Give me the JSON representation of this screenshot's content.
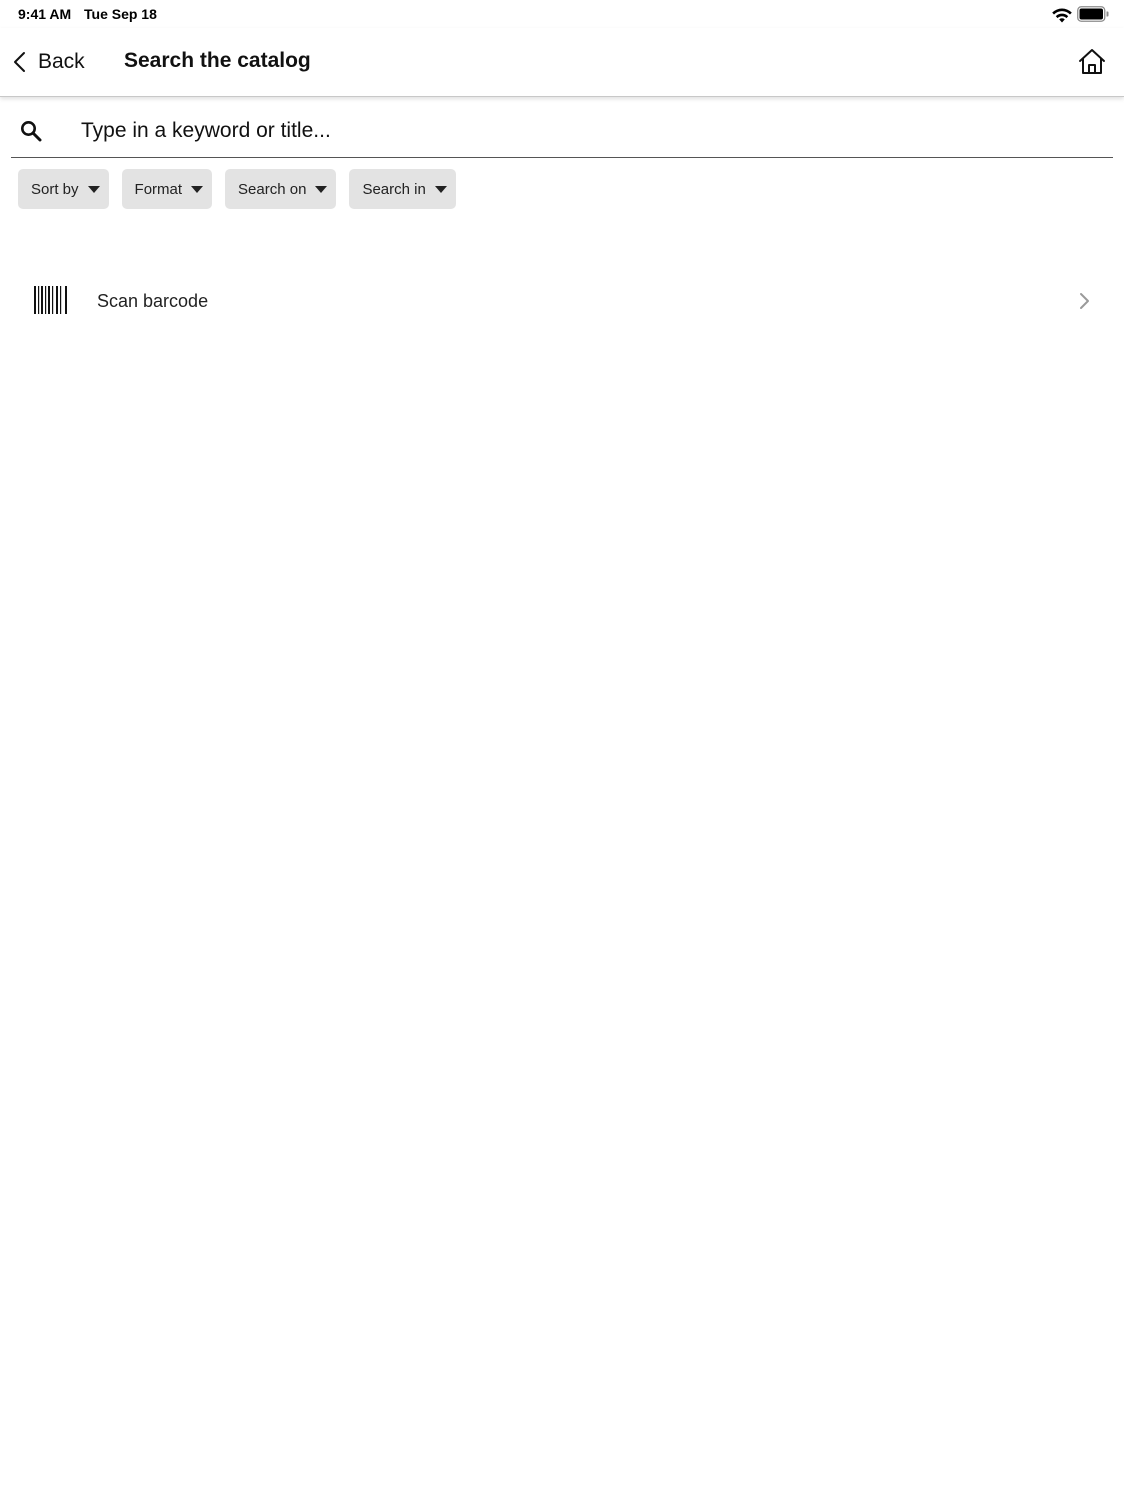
{
  "status_bar": {
    "time": "9:41 AM",
    "date": "Tue Sep 18",
    "wifi_icon": "wifi-icon",
    "battery_icon": "battery-icon"
  },
  "nav": {
    "back_label": "Back",
    "back_icon": "chevron-left-icon",
    "title": "Search the catalog",
    "home_icon": "home-icon"
  },
  "search": {
    "icon": "search-icon",
    "value": "",
    "placeholder": "Type in a keyword or title..."
  },
  "filters": [
    {
      "label": "Sort by"
    },
    {
      "label": "Format"
    },
    {
      "label": "Search on"
    },
    {
      "label": "Search in"
    }
  ],
  "scan": {
    "icon": "barcode-icon",
    "label": "Scan barcode",
    "chevron_icon": "chevron-right-icon"
  },
  "colors": {
    "chip_background": "#e3e3e3",
    "divider": "#555555",
    "text": "#111111"
  }
}
